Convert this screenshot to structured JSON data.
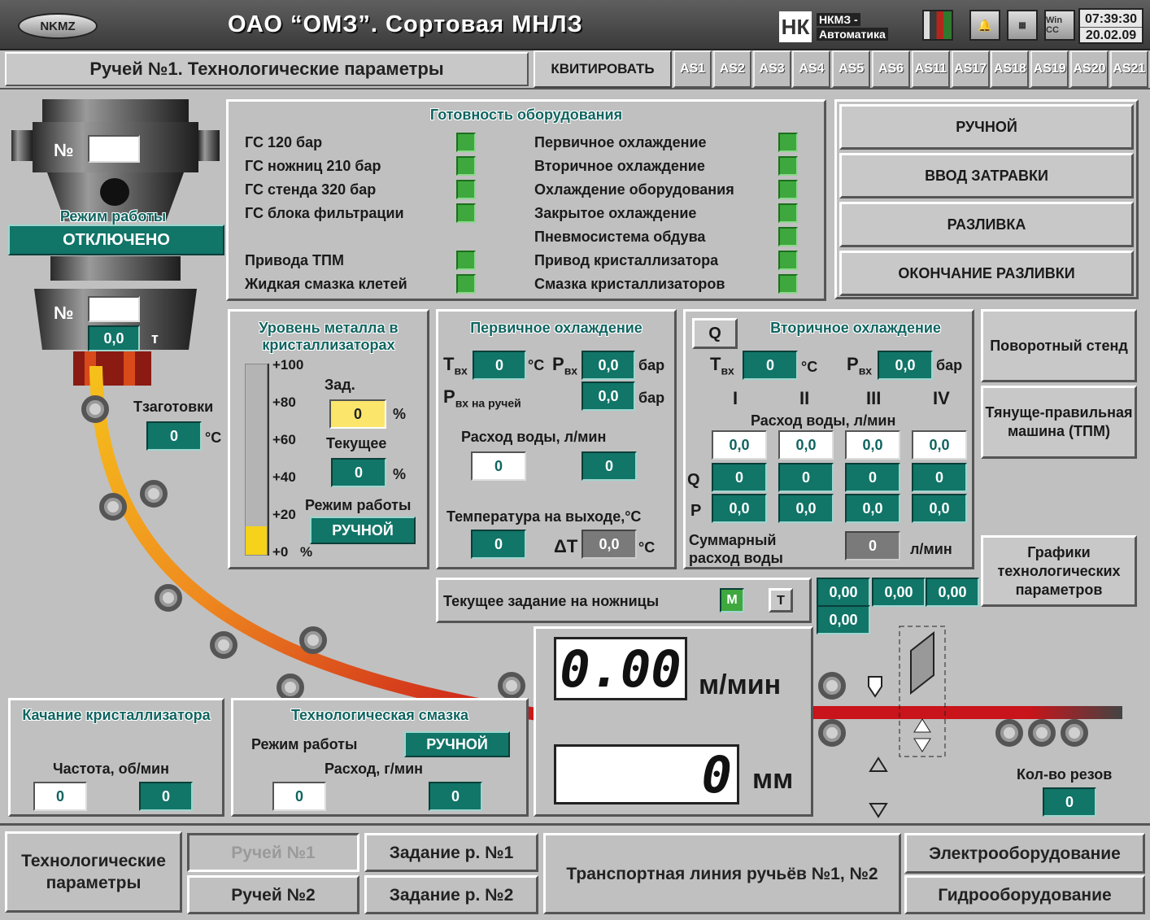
{
  "header": {
    "logo": "NKMZ",
    "title": "ОАО “ОМЗ”. Сортовая МНЛЗ",
    "brand_mark": "НК",
    "brand_line1": "НКМЗ -",
    "brand_line2": "Автоматика",
    "time": "07:39:30",
    "date": "20.02.09",
    "icons": [
      "status-bars-icon",
      "bell-icon",
      "calculator-icon",
      "wincc-icon"
    ],
    "wincc_label": "Win CC"
  },
  "subheader": {
    "title": "Ручей №1. Технологические параметры",
    "ack_button": "КВИТИРОВАТЬ",
    "as_tabs": [
      "AS1",
      "AS2",
      "AS3",
      "AS4",
      "AS5",
      "AS6",
      "AS11",
      "AS17",
      "AS18",
      "AS19",
      "AS20",
      "AS21"
    ]
  },
  "ladle": {
    "no_label": "№",
    "no_value": "",
    "mode_title": "Режим работы",
    "mode_value": "ОТКЛЮЧЕНО",
    "no2_label": "№",
    "weight": "0,0",
    "weight_unit": "т",
    "billet_label": "Тзаготовки",
    "billet_value": "0",
    "billet_unit": "°C"
  },
  "readiness": {
    "title": "Готовность оборудования",
    "left": [
      "ГС 120 бар",
      "ГС ножниц 210 бар",
      "ГС стенда 320 бар",
      "ГС блока фильтрации",
      "",
      "Привода ТПМ",
      "Жидкая смазка клетей"
    ],
    "right": [
      "Первичное охлаждение",
      "Вторичное охлаждение",
      "Охлаждение оборудования",
      "Закрытое охлаждение",
      "Пневмосистема обдува",
      "Привод кристаллизатора",
      "Смазка кристаллизаторов"
    ],
    "led_color": "#3ea83e"
  },
  "modes": {
    "manual": "РУЧНОЙ",
    "dummy": "ВВОД ЗАТРАВКИ",
    "casting": "РАЗЛИВКА",
    "end": "ОКОНЧАНИЕ РАЗЛИВКИ"
  },
  "level": {
    "title": "Уровень металла в кристаллизаторах",
    "scale": [
      "+100",
      "+80",
      "+60",
      "+40",
      "+20",
      "+0"
    ],
    "pct": "%",
    "set_label": "Зад.",
    "set_value": "0",
    "cur_label": "Текущее",
    "cur_value": "0",
    "mode_label": "Режим работы",
    "mode_value": "РУЧНОЙ",
    "fill_fraction": 0.15
  },
  "primary": {
    "title": "Первичное охлаждение",
    "t_in": "T",
    "t_sub": "вх",
    "t_value": "0",
    "t_unit": "°C",
    "p_in": "P",
    "p_sub": "вх",
    "p_value": "0,0",
    "p_unit": "бар",
    "p_strand": "P",
    "p_strand_sub": "вх на ручей",
    "p_strand_value": "0,0",
    "p_strand_unit": "бар",
    "flow_label": "Расход воды, л/мин",
    "flow_set": "0",
    "flow_value": "0",
    "tout_label": "Температура на выходе,°C",
    "tout_value": "0",
    "dt_label": "ΔT",
    "dt_value": "0,0",
    "dt_unit": "°C"
  },
  "secondary": {
    "q_button": "Q",
    "title": "Вторичное охлаждение",
    "t_in": "T",
    "t_sub": "вх",
    "t_value": "0",
    "t_unit": "°C",
    "p_in": "P",
    "p_sub": "вх",
    "p_value": "0,0",
    "p_unit": "бар",
    "zones": [
      "I",
      "II",
      "III",
      "IV"
    ],
    "flow_label": "Расход воды, л/мин",
    "set_row": [
      "0,0",
      "0,0",
      "0,0",
      "0,0"
    ],
    "q_label": "Q",
    "q_row": [
      "0",
      "0",
      "0",
      "0"
    ],
    "p_label": "P",
    "p_row": [
      "0,0",
      "0,0",
      "0,0",
      "0,0"
    ],
    "sum_label": "Суммарный расход воды",
    "sum_value": "0",
    "sum_unit": "л/мин"
  },
  "side_buttons": {
    "turret": "Поворотный стенд",
    "tpm": "Тянуще-правильная машина (ТПМ)",
    "charts": "Графики технологических параметров"
  },
  "shears": {
    "label": "Текущее задание на ножницы",
    "m": "M",
    "t": "T",
    "values": [
      "0,00",
      "0,00",
      "0,00"
    ],
    "value4": "0,00"
  },
  "speed": {
    "value": "0.00",
    "unit": "м/мин",
    "length": "0",
    "length_unit": "мм"
  },
  "cuts": {
    "label": "Кол-во резов",
    "value": "0"
  },
  "oscillation": {
    "title": "Качание кристаллизатора",
    "freq_label": "Частота, об/мин",
    "set": "0",
    "value": "0"
  },
  "lube": {
    "title": "Технологическая смазка",
    "mode_label": "Режим работы",
    "mode_value": "РУЧНОЙ",
    "flow_label": "Расход, г/мин",
    "set": "0",
    "value": "0"
  },
  "footer": {
    "tech": "Технологические параметры",
    "strand1": "Ручей №1",
    "strand2": "Ручей №2",
    "task1": "Задание р. №1",
    "task2": "Задание р. №2",
    "transport": "Транспортная линия ручьёв  №1, №2",
    "electric": "Электрооборудование",
    "hydraulic": "Гидрооборудование"
  },
  "colors": {
    "teal": "#117568",
    "led": "#3ea83e",
    "yellow": "#fbe66b"
  }
}
